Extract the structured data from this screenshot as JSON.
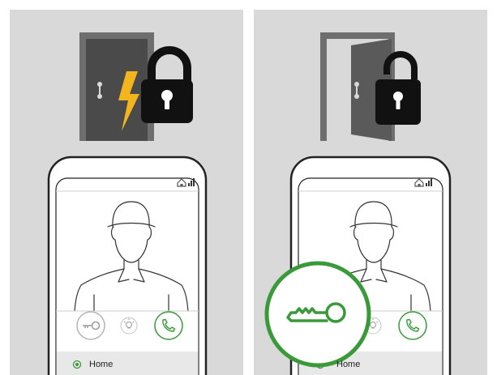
{
  "colors": {
    "panel_bg": "#d9d9d9",
    "door_dark": "#4a4a4a",
    "door_frame": "#6e6e6e",
    "lock_black": "#111111",
    "lightning": "#f2b51e",
    "phone_outline": "#222222",
    "phone_screen": "#ffffff",
    "phone_bottom": "#e8e8e8",
    "green_accent": "#3a9a3a",
    "grey_button": "#b5b5b5"
  },
  "panels": [
    {
      "state": "locked",
      "door": "closed",
      "lock": "closed",
      "alert_icon": "lightning-icon",
      "status_icons": [
        "home-icon",
        "signal-bars-icon"
      ],
      "buttons": [
        "key-button",
        "light-button",
        "call-button"
      ],
      "location_label": "Home",
      "highlighted_button": null
    },
    {
      "state": "unlocked",
      "door": "open",
      "lock": "open",
      "alert_icon": null,
      "status_icons": [
        "home-icon",
        "signal-bars-icon"
      ],
      "buttons": [
        "key-button",
        "light-button",
        "call-button"
      ],
      "location_label": "Home",
      "highlighted_button": "key-button"
    }
  ]
}
